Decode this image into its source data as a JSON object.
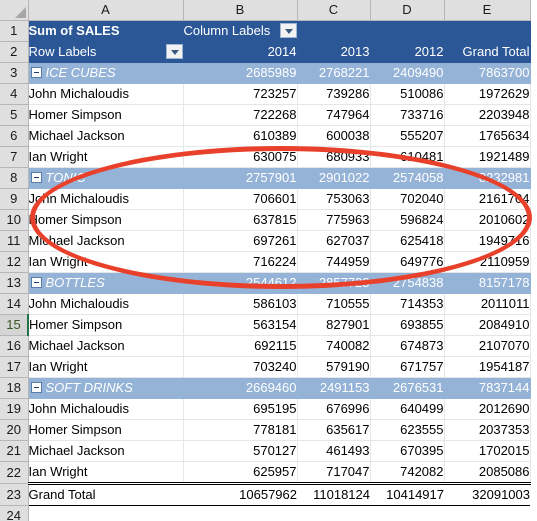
{
  "spreadsheet": {
    "column_headers": [
      "A",
      "B",
      "C",
      "D",
      "E"
    ],
    "row_numbers": [
      "1",
      "2",
      "3",
      "4",
      "5",
      "6",
      "7",
      "8",
      "9",
      "10",
      "11",
      "12",
      "13",
      "14",
      "15",
      "16",
      "17",
      "18",
      "19",
      "20",
      "21",
      "22",
      "23",
      "24"
    ],
    "active_row": "15",
    "icons": {
      "select_all": "select-all-triangle-icon",
      "row_labels_filter": "filter-dropdown-icon",
      "column_labels_filter": "filter-dropdown-icon",
      "collapse": "minus-collapse-icon"
    },
    "colors": {
      "header_band": "#2b5797",
      "category_band": "#95b3d7",
      "annotation": "#e8402a",
      "active_row_accent": "#217346",
      "gutter": "#dfdfdf"
    }
  },
  "pivot": {
    "value_field_title": "Sum of SALES",
    "column_labels_title": "Column Labels",
    "row_labels_title": "Row Labels",
    "column_headers": [
      "2014",
      "2013",
      "2012",
      "Grand Total"
    ],
    "groups": [
      {
        "name": "ICE CUBES",
        "row": "3",
        "totals": [
          "2685989",
          "2768221",
          "2409490",
          "7863700"
        ],
        "members": [
          {
            "row": "4",
            "name": "John Michaloudis",
            "values": [
              "723257",
              "739286",
              "510086",
              "1972629"
            ]
          },
          {
            "row": "5",
            "name": "Homer Simpson",
            "values": [
              "722268",
              "747964",
              "733716",
              "2203948"
            ]
          },
          {
            "row": "6",
            "name": "Michael Jackson",
            "values": [
              "610389",
              "600038",
              "555207",
              "1765634"
            ]
          },
          {
            "row": "7",
            "name": "Ian Wright",
            "values": [
              "630075",
              "680933",
              "610481",
              "1921489"
            ]
          }
        ]
      },
      {
        "name": "TONIC",
        "row": "8",
        "totals": [
          "2757901",
          "2901022",
          "2574058",
          "8232981"
        ],
        "members": [
          {
            "row": "9",
            "name": "John Michaloudis",
            "values": [
              "706601",
              "753063",
              "702040",
              "2161704"
            ]
          },
          {
            "row": "10",
            "name": "Homer Simpson",
            "values": [
              "637815",
              "775963",
              "596824",
              "2010602"
            ]
          },
          {
            "row": "11",
            "name": "Michael Jackson",
            "values": [
              "697261",
              "627037",
              "625418",
              "1949716"
            ]
          },
          {
            "row": "12",
            "name": "Ian Wright",
            "values": [
              "716224",
              "744959",
              "649776",
              "2110959"
            ]
          }
        ]
      },
      {
        "name": "BOTTLES",
        "row": "13",
        "totals": [
          "2544612",
          "2857728",
          "2754838",
          "8157178"
        ],
        "members": [
          {
            "row": "14",
            "name": "John Michaloudis",
            "values": [
              "586103",
              "710555",
              "714353",
              "2011011"
            ]
          },
          {
            "row": "15",
            "name": "Homer Simpson",
            "values": [
              "563154",
              "827901",
              "693855",
              "2084910"
            ]
          },
          {
            "row": "16",
            "name": "Michael Jackson",
            "values": [
              "692115",
              "740082",
              "674873",
              "2107070"
            ]
          },
          {
            "row": "17",
            "name": "Ian Wright",
            "values": [
              "703240",
              "579190",
              "671757",
              "1954187"
            ]
          }
        ]
      },
      {
        "name": "SOFT DRINKS",
        "row": "18",
        "totals": [
          "2669460",
          "2491153",
          "2676531",
          "7837144"
        ],
        "members": [
          {
            "row": "19",
            "name": "John Michaloudis",
            "values": [
              "695195",
              "676996",
              "640499",
              "2012690"
            ]
          },
          {
            "row": "20",
            "name": "Homer Simpson",
            "values": [
              "778181",
              "635617",
              "623555",
              "2037353"
            ]
          },
          {
            "row": "21",
            "name": "Michael Jackson",
            "values": [
              "570127",
              "461493",
              "670395",
              "1702015"
            ]
          },
          {
            "row": "22",
            "name": "Ian Wright",
            "values": [
              "625957",
              "717047",
              "742082",
              "2085086"
            ]
          }
        ]
      }
    ],
    "grand_total": {
      "row": "23",
      "label": "Grand Total",
      "values": [
        "10657962",
        "11018124",
        "10414917",
        "32091003"
      ]
    }
  },
  "annotation": {
    "shape": "oval",
    "covers_rows": "7-12",
    "color": "#e8402a"
  }
}
